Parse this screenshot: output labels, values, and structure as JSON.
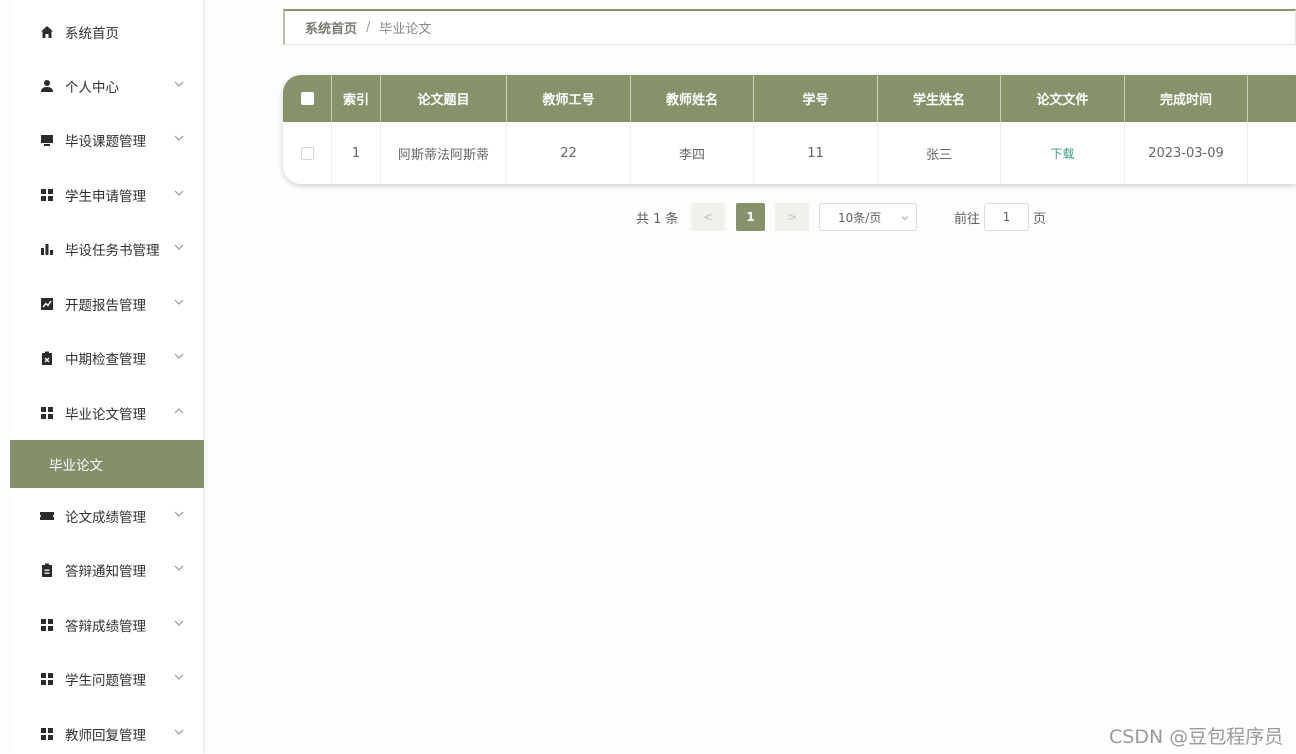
{
  "sidebar": {
    "items": [
      {
        "label": "系统首页",
        "icon": "home-icon"
      },
      {
        "label": "个人中心",
        "icon": "user-icon"
      },
      {
        "label": "毕设课题管理",
        "icon": "monitor-icon"
      },
      {
        "label": "学生申请管理",
        "icon": "grid-icon"
      },
      {
        "label": "毕设任务书管理",
        "icon": "bar-chart-icon"
      },
      {
        "label": "开题报告管理",
        "icon": "line-chart-icon"
      },
      {
        "label": "中期检查管理",
        "icon": "clipboard-x-icon"
      },
      {
        "label": "毕业论文管理",
        "icon": "grid-icon"
      },
      {
        "label": "论文成绩管理",
        "icon": "ticket-icon"
      },
      {
        "label": "答辩通知管理",
        "icon": "clipboard-icon"
      },
      {
        "label": "答辩成绩管理",
        "icon": "grid-icon"
      },
      {
        "label": "学生问题管理",
        "icon": "grid-icon"
      },
      {
        "label": "教师回复管理",
        "icon": "grid-icon"
      }
    ],
    "active_sub": "毕业论文"
  },
  "breadcrumb": {
    "home": "系统首页",
    "separator": "/",
    "current": "毕业论文"
  },
  "table": {
    "headers": [
      "索引",
      "论文题目",
      "教师工号",
      "教师姓名",
      "学号",
      "学生姓名",
      "论文文件",
      "完成时间"
    ],
    "rows": [
      {
        "index": "1",
        "title": "阿斯蒂法阿斯蒂",
        "teacher_no": "22",
        "teacher_name": "李四",
        "student_no": "11",
        "student_name": "张三",
        "file": "下载",
        "date": "2023-03-09"
      }
    ]
  },
  "pagination": {
    "total": "共 1 条",
    "prev": "<",
    "current_page": "1",
    "next": ">",
    "page_size": "10条/页",
    "goto_label": "前往",
    "goto_value": "1",
    "page_suffix": "页"
  },
  "watermark": "CSDN @豆包程序员",
  "colors": {
    "accent": "#86936a",
    "active_bg": "#83906a",
    "link": "#3aa07a"
  }
}
